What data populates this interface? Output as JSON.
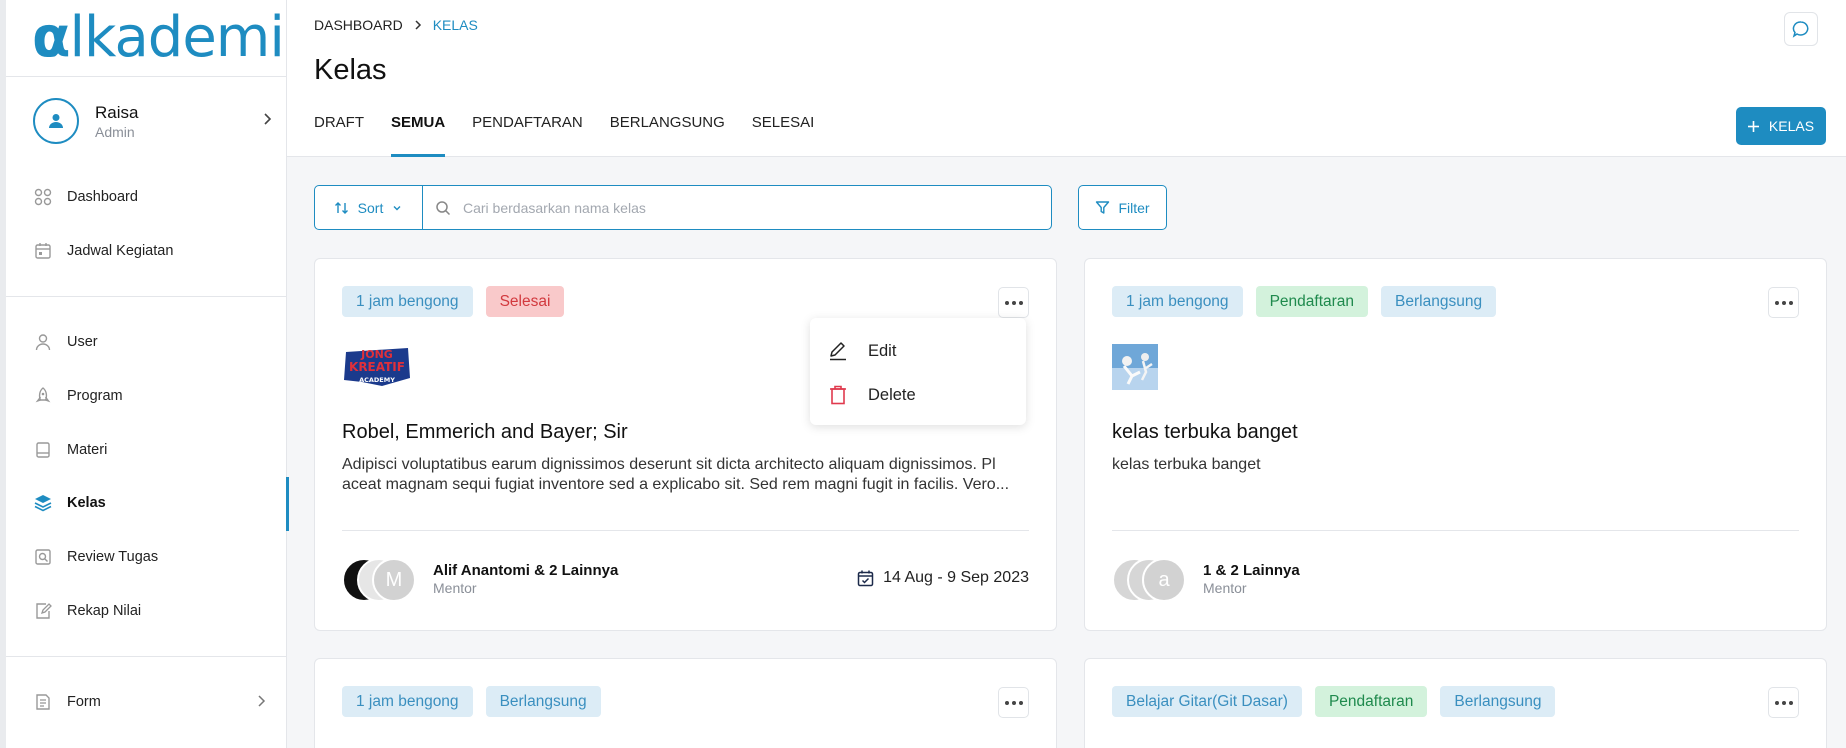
{
  "sidebar": {
    "logo": {
      "a": "α",
      "rest": "lkademi"
    },
    "profile": {
      "name": "Raisa",
      "role": "Admin"
    },
    "items": [
      {
        "label": "Dashboard",
        "icon": "grid-icon"
      },
      {
        "label": "Jadwal Kegiatan",
        "icon": "calendar-icon"
      },
      {
        "label": "User",
        "icon": "user-icon"
      },
      {
        "label": "Program",
        "icon": "rocket-icon"
      },
      {
        "label": "Materi",
        "icon": "book-icon"
      },
      {
        "label": "Kelas",
        "icon": "layers-icon",
        "active": true
      },
      {
        "label": "Review Tugas",
        "icon": "review-icon"
      },
      {
        "label": "Rekap Nilai",
        "icon": "edit-doc-icon"
      },
      {
        "label": "Form",
        "icon": "form-icon"
      }
    ]
  },
  "header": {
    "breadcrumb": [
      "DASHBOARD",
      "KELAS"
    ],
    "title": "Kelas",
    "tabs": [
      "DRAFT",
      "SEMUA",
      "PENDAFTARAN",
      "BERLANGSUNG",
      "SELESAI"
    ],
    "active_tab": "SEMUA",
    "add_button": "KELAS"
  },
  "toolbar": {
    "sort_label": "Sort",
    "search_placeholder": "Cari berdasarkan nama kelas",
    "filter_label": "Filter"
  },
  "cards": [
    {
      "badges": [
        "1 jam bengong",
        "Selesai"
      ],
      "title": "Robel, Emmerich and Bayer; Sir",
      "description": "Adipisci voluptatibus earum dignissimos deserunt sit dicta architecto aliquam dignissimos. Pl aceat magnam sequi fugiat inventore sed a explicabo sit. Sed rem magni fugit in facilis. Vero...",
      "logo": {
        "line1": "JONG",
        "line2": "KREATIF",
        "line3": "ACADEMY"
      },
      "mentor": "Alif Anantomi & 2 Lainnya",
      "mentor_role": "Mentor",
      "avatar_letter": "M",
      "date": "14 Aug - 9 Sep 2023"
    },
    {
      "badges": [
        "1 jam bengong",
        "Pendaftaran",
        "Berlangsung"
      ],
      "title": "kelas terbuka banget",
      "description": "kelas terbuka banget",
      "mentor": "1 & 2 Lainnya",
      "mentor_role": "Mentor",
      "avatar_letter": "a"
    },
    {
      "badges": [
        "1 jam bengong",
        "Berlangsung"
      ]
    },
    {
      "badges": [
        "Belajar Gitar(Git Dasar)",
        "Pendaftaran",
        "Berlangsung"
      ]
    }
  ],
  "menu": {
    "edit": "Edit",
    "delete": "Delete"
  },
  "colors": {
    "accent": "#1e8cc1",
    "danger": "#d2393e",
    "success": "#1f8a4d"
  }
}
